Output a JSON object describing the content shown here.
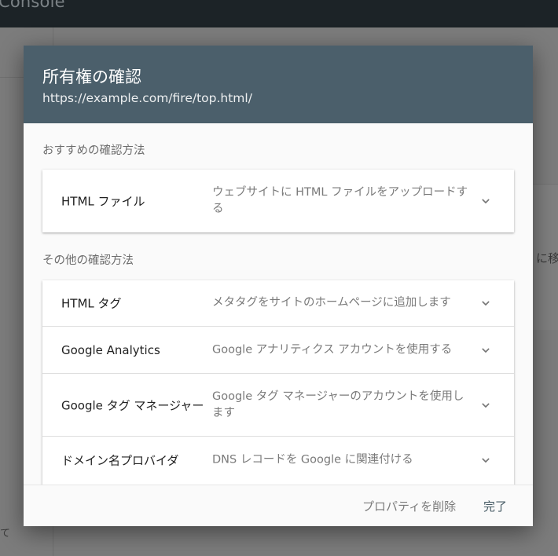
{
  "background": {
    "brand_text": "Console",
    "card_text": "に移",
    "side_text": "て"
  },
  "dialog": {
    "title": "所有権の確認",
    "url": "https://example.com/fire/top.html/",
    "recommended_label": "おすすめの確認方法",
    "recommended": [
      {
        "title": "HTML ファイル",
        "description": "ウェブサイトに HTML ファイルをアップロードする",
        "icon": "chevron-down-icon"
      }
    ],
    "other_label": "その他の確認方法",
    "other": [
      {
        "title": "HTML タグ",
        "description": "メタタグをサイトのホームページに追加します",
        "icon": "chevron-down-icon"
      },
      {
        "title": "Google Analytics",
        "description": "Google アナリティクス アカウントを使用する",
        "icon": "chevron-down-icon"
      },
      {
        "title": "Google タグ マネージャー",
        "description": "Google タグ マネージャーのアカウントを使用します",
        "icon": "chevron-down-icon"
      },
      {
        "title": "ドメイン名プロバイダ",
        "description": "DNS レコードを Google に関連付ける",
        "icon": "chevron-down-icon"
      }
    ],
    "footer": {
      "delete_label": "プロパティを削除",
      "done_label": "完了"
    }
  },
  "colors": {
    "header_bg": "#4b5f6b",
    "done_button": "#455a64",
    "topbar_bg": "#1c2327"
  }
}
